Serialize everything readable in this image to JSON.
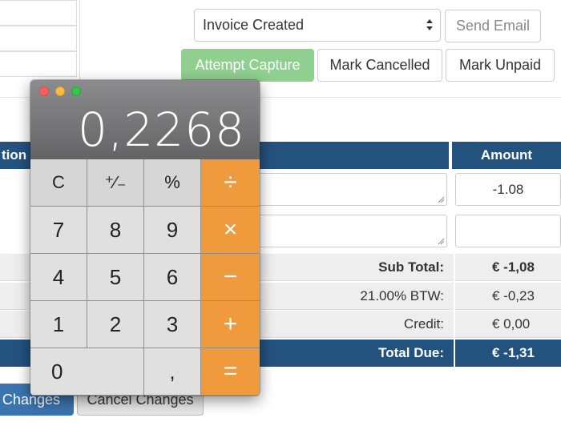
{
  "status_select": {
    "value": "Invoice Created"
  },
  "buttons": {
    "send_email": "Send Email",
    "attempt_capture": "Attempt Capture",
    "mark_cancelled": "Mark Cancelled",
    "mark_unpaid": "Mark Unpaid",
    "save_changes": "e Changes",
    "cancel_changes": "Cancel Changes"
  },
  "table": {
    "headers": {
      "description": "tion",
      "amount": "Amount"
    },
    "rows": [
      {
        "amount": "-1.08"
      },
      {
        "amount": ""
      }
    ]
  },
  "summary": {
    "subtotal": {
      "label": "Sub Total:",
      "value": "€ -1,08"
    },
    "tax": {
      "label": "21.00% BTW:",
      "value": "€ -0,23"
    },
    "credit": {
      "label": "Credit:",
      "value": "€ 0,00"
    },
    "total": {
      "label": "Total Due:",
      "value": "€ -1,31"
    }
  },
  "calculator": {
    "display": "0,2268",
    "keys": {
      "clear": "C",
      "sign": "⁺∕₋",
      "percent": "%",
      "divide": "÷",
      "k7": "7",
      "k8": "8",
      "k9": "9",
      "multiply": "×",
      "k4": "4",
      "k5": "5",
      "k6": "6",
      "minus": "−",
      "k1": "1",
      "k2": "2",
      "k3": "3",
      "plus": "+",
      "k0": "0",
      "decimal": ",",
      "equals": "="
    }
  },
  "colors": {
    "header_blue": "#24527e",
    "capture_green": "#8fcf8f",
    "calc_orange": "#f09a3e"
  }
}
